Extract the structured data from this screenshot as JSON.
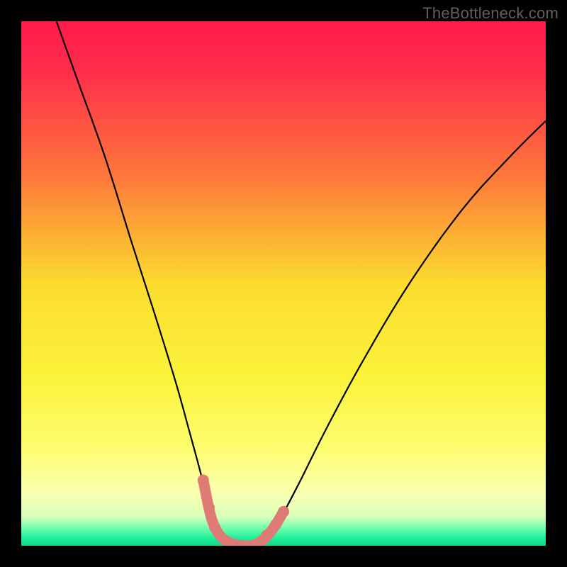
{
  "watermark": "TheBottleneck.com",
  "chart_data": {
    "type": "line",
    "title": "",
    "xlabel": "",
    "ylabel": "",
    "background_gradient": {
      "stops": [
        {
          "offset": 0.0,
          "color": "#ff1a4b"
        },
        {
          "offset": 0.1,
          "color": "#ff2f4b"
        },
        {
          "offset": 0.3,
          "color": "#fd7a3a"
        },
        {
          "offset": 0.5,
          "color": "#fbdc2e"
        },
        {
          "offset": 0.68,
          "color": "#fbf33a"
        },
        {
          "offset": 0.82,
          "color": "#fdfe73"
        },
        {
          "offset": 0.9,
          "color": "#fbffb2"
        },
        {
          "offset": 0.945,
          "color": "#d7ffb9"
        },
        {
          "offset": 0.965,
          "color": "#79ffb0"
        },
        {
          "offset": 0.985,
          "color": "#1fef9a"
        },
        {
          "offset": 1.0,
          "color": "#13d884"
        }
      ]
    },
    "series": [
      {
        "name": "bottleneck-curve",
        "stroke": "#000000",
        "stroke_width": 2.2,
        "points": [
          {
            "x": 0.067,
            "y": 1.0
          },
          {
            "x": 0.11,
            "y": 0.88
          },
          {
            "x": 0.16,
            "y": 0.74
          },
          {
            "x": 0.21,
            "y": 0.58
          },
          {
            "x": 0.255,
            "y": 0.44
          },
          {
            "x": 0.295,
            "y": 0.31
          },
          {
            "x": 0.32,
            "y": 0.22
          },
          {
            "x": 0.343,
            "y": 0.135
          },
          {
            "x": 0.356,
            "y": 0.08
          },
          {
            "x": 0.37,
            "y": 0.035
          },
          {
            "x": 0.385,
            "y": 0.01
          },
          {
            "x": 0.41,
            "y": 0.0
          },
          {
            "x": 0.44,
            "y": 0.0
          },
          {
            "x": 0.465,
            "y": 0.012
          },
          {
            "x": 0.49,
            "y": 0.045
          },
          {
            "x": 0.53,
            "y": 0.12
          },
          {
            "x": 0.58,
            "y": 0.22
          },
          {
            "x": 0.65,
            "y": 0.35
          },
          {
            "x": 0.74,
            "y": 0.5
          },
          {
            "x": 0.84,
            "y": 0.64
          },
          {
            "x": 0.93,
            "y": 0.74
          },
          {
            "x": 1.0,
            "y": 0.81
          }
        ]
      },
      {
        "name": "valley-overlay",
        "stroke": "#e07a74",
        "stroke_width": 15,
        "linecap": "round",
        "points": [
          {
            "x": 0.347,
            "y": 0.125
          },
          {
            "x": 0.356,
            "y": 0.08
          },
          {
            "x": 0.365,
            "y": 0.045
          },
          {
            "x": 0.38,
            "y": 0.018
          },
          {
            "x": 0.4,
            "y": 0.005
          },
          {
            "x": 0.425,
            "y": 0.0
          },
          {
            "x": 0.448,
            "y": 0.003
          },
          {
            "x": 0.468,
            "y": 0.018
          },
          {
            "x": 0.485,
            "y": 0.04
          },
          {
            "x": 0.5,
            "y": 0.065
          }
        ]
      }
    ],
    "markers": [
      {
        "series": "valley-overlay",
        "x": 0.347,
        "y": 0.125,
        "r": 8,
        "fill": "#e07a74"
      },
      {
        "series": "valley-overlay",
        "x": 0.358,
        "y": 0.073,
        "r": 8,
        "fill": "#e07a74"
      },
      {
        "series": "valley-overlay",
        "x": 0.369,
        "y": 0.035,
        "r": 8,
        "fill": "#e07a74"
      },
      {
        "series": "valley-overlay",
        "x": 0.468,
        "y": 0.02,
        "r": 8,
        "fill": "#e07a74"
      },
      {
        "series": "valley-overlay",
        "x": 0.485,
        "y": 0.04,
        "r": 8,
        "fill": "#e07a74"
      },
      {
        "series": "valley-overlay",
        "x": 0.5,
        "y": 0.065,
        "r": 8,
        "fill": "#e07a74"
      }
    ],
    "xlim": [
      0,
      1
    ],
    "ylim": [
      0,
      1
    ]
  }
}
